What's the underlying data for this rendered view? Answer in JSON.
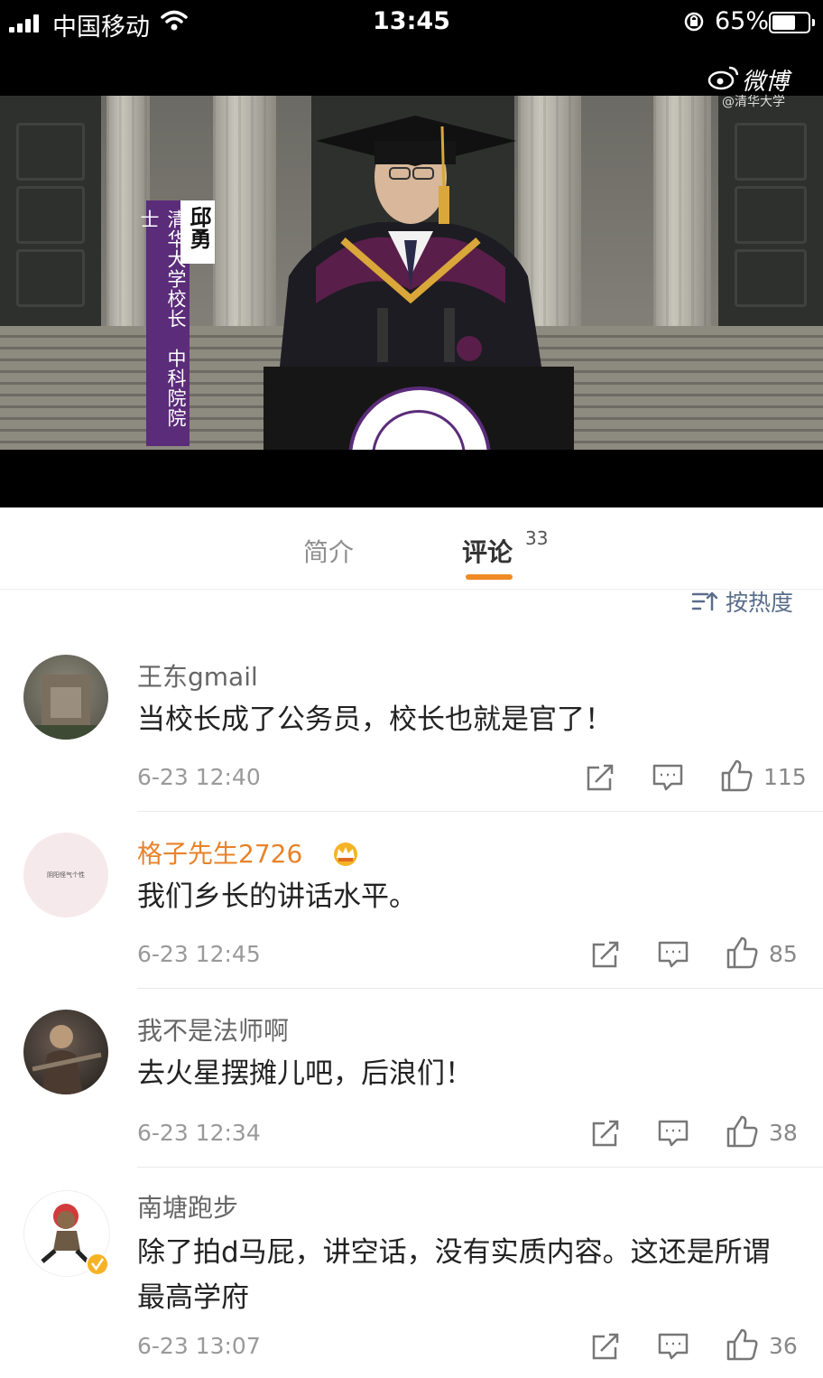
{
  "status_bar": {
    "carrier": "中国移动",
    "time": "13:45",
    "battery": "65%",
    "battery_level": 0.65
  },
  "video": {
    "watermark": "微博",
    "watermark_sub": "@清华大学",
    "caption_name": "邱勇",
    "caption_title": "清华大学校长　中科院院士"
  },
  "tabs": {
    "intro": "简介",
    "comments": "评论",
    "comment_count": "33"
  },
  "sort": {
    "label": "按热度"
  },
  "comments": [
    {
      "user": "王东gmail",
      "text": "当校长成了公务员，校长也就是官了！",
      "time": "6-23 12:40",
      "likes": "115"
    },
    {
      "user": "格子先生2726",
      "vip": true,
      "avatar_text": "阴阳怪气个性",
      "text": "我们乡长的讲话水平。",
      "time": "6-23 12:45",
      "likes": "85"
    },
    {
      "user": "我不是法师啊",
      "text": "去火星摆摊儿吧，后浪们！",
      "time": "6-23 12:34",
      "likes": "38"
    },
    {
      "user": "南塘跑步",
      "verified": true,
      "text": "除了拍d马屁，讲空话，没有实质内容。这还是所谓最高学府",
      "time": "6-23 13:07",
      "likes": "36"
    }
  ],
  "colors": {
    "accent": "#f08a24",
    "vip_name": "#e8822a",
    "caption_bg": "#5b2c7a",
    "sort_text": "#5a6d8a"
  },
  "icons": [
    "signal-icon",
    "wifi-icon",
    "rotation-lock-icon",
    "battery-icon",
    "weibo-logo-icon",
    "sort-icon",
    "repost-icon",
    "comment-icon",
    "like-icon",
    "vip-crown-icon",
    "verified-badge-icon"
  ]
}
